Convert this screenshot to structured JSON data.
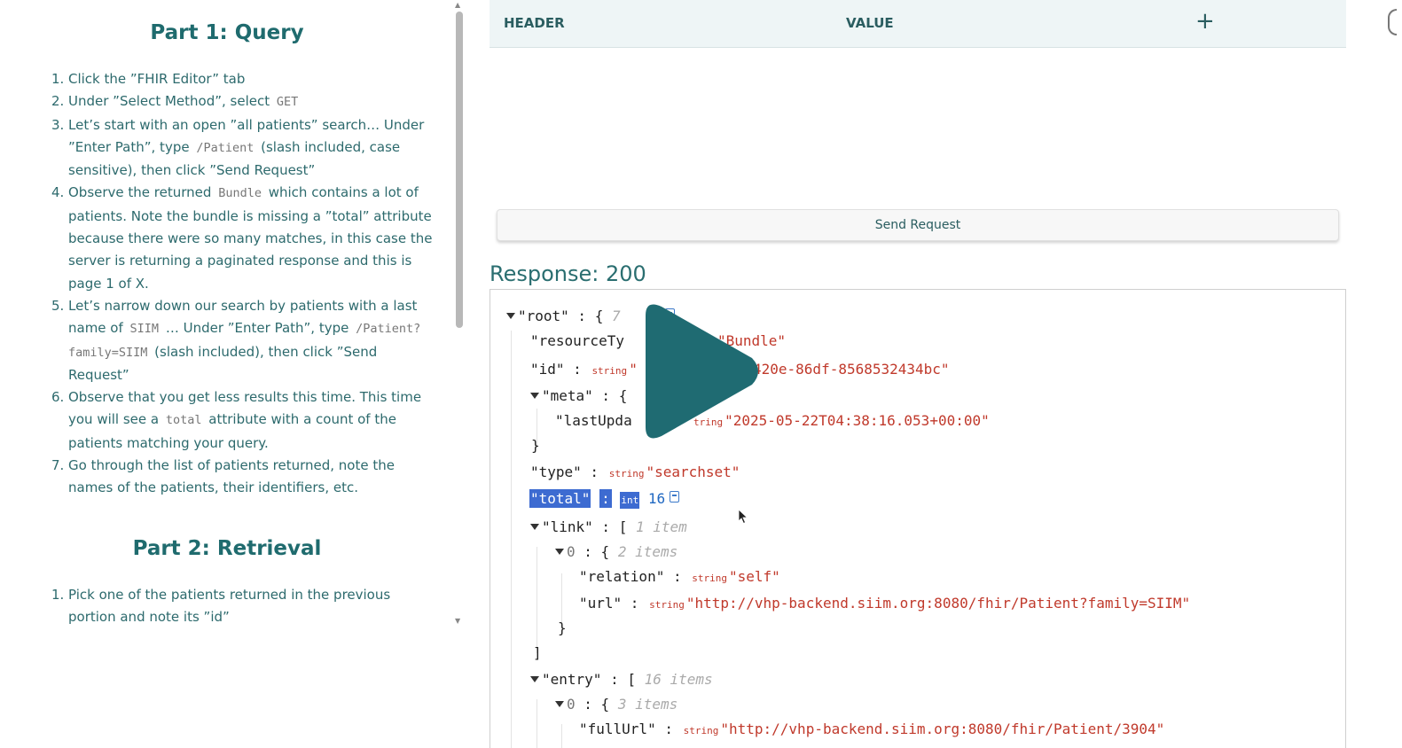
{
  "instructions": {
    "part1_title": "Part 1: Query",
    "part1_steps": [
      {
        "n": "1.",
        "text": "Click the ”FHIR Editor” tab"
      },
      {
        "n": "2.",
        "pre": "Under ”Select Method”, select ",
        "code": "GET",
        "post": ""
      },
      {
        "n": "3.",
        "pre": "Let’s start with an open ”all patients” search… Under ”Enter Path”, type ",
        "code": "/Patient",
        "post": " (slash included, case sensitive), then click ”Send Request”"
      },
      {
        "n": "4.",
        "pre": "Observe the returned ",
        "code": "Bundle",
        "post": " which contains a lot of patients. Note the bundle is missing a ”total” attribute because there were so many matches, in this case the server is returning a paginated response and this is page 1 of X."
      },
      {
        "n": "5.",
        "pre": "Let’s narrow down our search by patients with a last name of ",
        "code": "SIIM",
        "post": " … Under ”Enter Path”, type ",
        "code2": "/Patient?family=SIIM",
        "post2": " (slash included), then click ”Send Request”"
      },
      {
        "n": "6.",
        "pre": "Observe that you get less results this time. This time you will see a ",
        "code": "total",
        "post": " attribute with a count of the patients matching your query."
      },
      {
        "n": "7.",
        "text": "Go through the list of patients returned, note the names of the patients, their identifiers, etc."
      }
    ],
    "part2_title": "Part 2: Retrieval",
    "part2_steps": [
      {
        "n": "1.",
        "text": "Pick one of the patients returned in the previous portion and note its ”id”"
      }
    ]
  },
  "headers_table": {
    "col_header": "HEADER",
    "col_value": "VALUE",
    "add_symbol": "+"
  },
  "send_request_label": "Send Request",
  "response_title": "Response: 200",
  "json": {
    "root_key": "\"root\"",
    "root_count": "7",
    "resource_type_key": "\"resourceTy",
    "resource_type_val": "\"Bundle\"",
    "id_key": "\"id\"",
    "id_type": "string",
    "id_val_visible": "420e-86df-8568532434bc\"",
    "id_val_prefix": "\"",
    "meta_key": "\"meta\"",
    "last_updated_key": "\"lastUpda",
    "last_updated_type": "tring",
    "last_updated_val": "\"2025-05-22T04:38:16.053+00:00\"",
    "type_key": "\"type\"",
    "type_type": "string",
    "type_val": "\"searchset\"",
    "total_key": "\"total\"",
    "total_type": "int",
    "total_val": "16",
    "link_key": "\"link\"",
    "link_count": "1 item",
    "link0_key": "0",
    "link0_count": "2 items",
    "relation_key": "\"relation\"",
    "relation_type": "string",
    "relation_val": "\"self\"",
    "url_key": "\"url\"",
    "url_type": "string",
    "url_val": "\"http://vhp-backend.siim.org:8080/fhir/Patient?family=SIIM\"",
    "entry_key": "\"entry\"",
    "entry_count": "16 items",
    "entry0_key": "0",
    "entry0_count": "3 items",
    "fullurl_key": "\"fullUrl\"",
    "fullurl_type": "string",
    "fullurl_val": "\"http://vhp-backend.siim.org:8080/fhir/Patient/3904\""
  },
  "icons": {
    "play": "play-icon",
    "copy": "copy-icon",
    "collapse": "triangle-down-icon",
    "cursor": "mouse-cursor-icon"
  },
  "colors": {
    "accent": "#1f6b6e",
    "play_overlay": "#1f6b72",
    "json_string": "#c0392b",
    "json_number": "#2068c2",
    "highlight": "#3d6bd1"
  }
}
